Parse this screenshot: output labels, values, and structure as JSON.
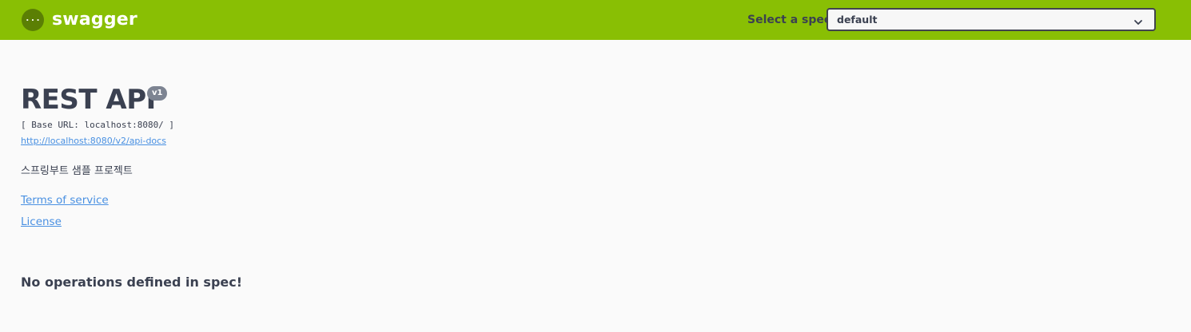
{
  "topbar": {
    "brand": "swagger",
    "logo_icon": "swagger-logo-icon",
    "spec_label": "Select a spec",
    "spec_selected": "default",
    "bg_color": "#89bf04"
  },
  "info": {
    "title": "REST API",
    "version": "v1",
    "base_url": "[ Base URL: localhost:8080/ ]",
    "docs_url": "http://localhost:8080/v2/api-docs",
    "description": "스프링부트 샘플 프로젝트",
    "terms_link": "Terms of service",
    "license_link": "License"
  },
  "operations": {
    "empty_message": "No operations defined in spec!"
  }
}
